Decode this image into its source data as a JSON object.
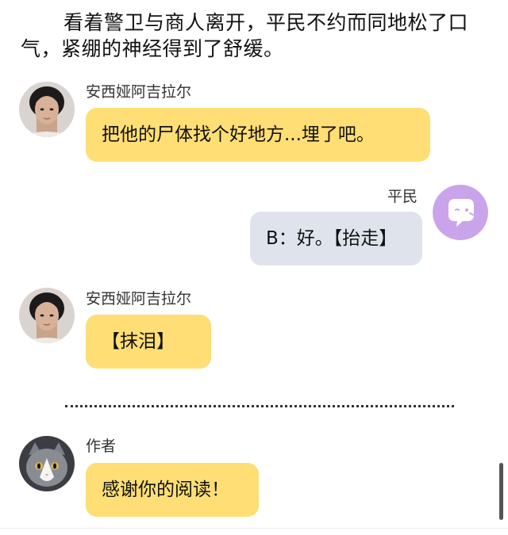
{
  "narration": "看着警卫与商人离开，平民不约而同地松了口气，紧绷的神经得到了舒缓。",
  "messages": [
    {
      "speaker": "安西娅阿吉拉尔",
      "text": "把他的尸体找个好地方...埋了吧。",
      "side": "left",
      "avatar": "girl-avatar"
    },
    {
      "speaker": "平民",
      "text": "B：好。【抬走】",
      "side": "right",
      "avatar": "chat-bubble-avatar"
    },
    {
      "speaker": "安西娅阿吉拉尔",
      "text": "【抹泪】",
      "side": "left",
      "avatar": "girl-avatar"
    },
    {
      "speaker": "作者",
      "text": "感谢你的阅读！",
      "side": "left",
      "avatar": "cat-avatar"
    }
  ],
  "colors": {
    "left_bubble": "#ffde75",
    "right_bubble": "#dfe4ec",
    "npc_avatar": "#c9a4ea"
  }
}
